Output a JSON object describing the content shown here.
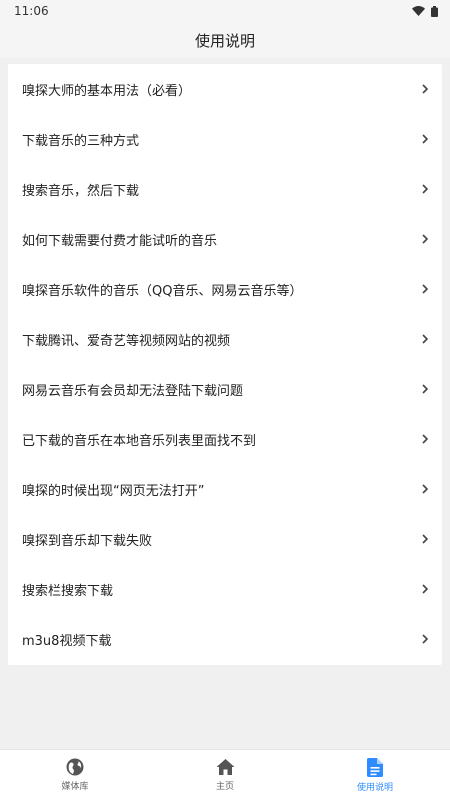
{
  "status_bar": {
    "time": "11:06"
  },
  "header": {
    "title": "使用说明"
  },
  "list": {
    "items": [
      {
        "label": "嗅探大师的基本用法（必看）"
      },
      {
        "label": "下载音乐的三种方式"
      },
      {
        "label": "搜索音乐，然后下载"
      },
      {
        "label": "如何下载需要付费才能试听的音乐"
      },
      {
        "label": "嗅探音乐软件的音乐（QQ音乐、网易云音乐等）"
      },
      {
        "label": "下载腾讯、爱奇艺等视频网站的视频"
      },
      {
        "label": "网易云音乐有会员却无法登陆下载问题"
      },
      {
        "label": "已下载的音乐在本地音乐列表里面找不到"
      },
      {
        "label": "嗅探的时候出现“网页无法打开”"
      },
      {
        "label": "嗅探到音乐却下载失败"
      },
      {
        "label": "搜索栏搜索下载"
      },
      {
        "label": "m3u8视频下载"
      }
    ]
  },
  "bottom_nav": {
    "items": [
      {
        "label": "媒体库",
        "icon": "globe-icon",
        "active": false
      },
      {
        "label": "主页",
        "icon": "home-icon",
        "active": false
      },
      {
        "label": "使用说明",
        "icon": "document-icon",
        "active": true
      }
    ]
  },
  "colors": {
    "accent": "#2f8cff",
    "background": "#f0f0f0",
    "card": "#ffffff"
  }
}
